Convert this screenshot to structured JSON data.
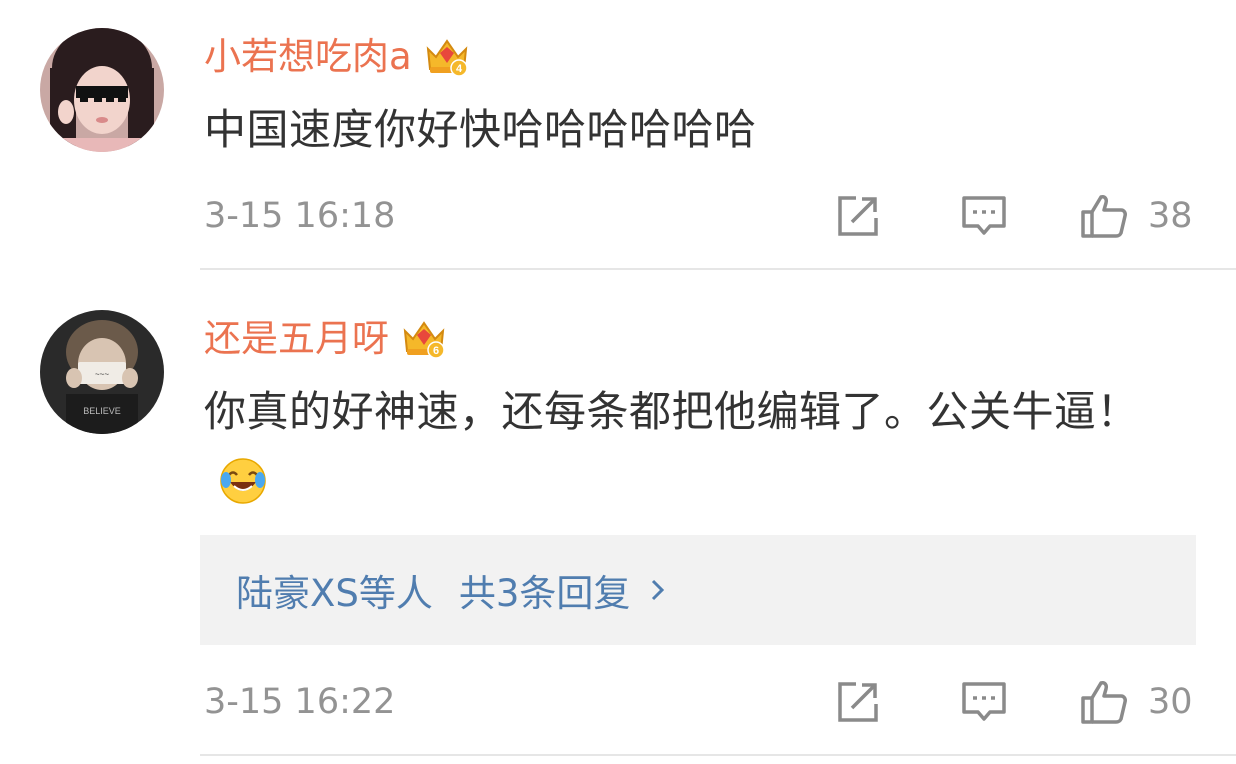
{
  "comments": [
    {
      "username": "小若想吃肉a",
      "vip_level": "4",
      "text": "中国速度你好快哈哈哈哈哈哈",
      "timestamp": "3-15 16:18",
      "likes": "38",
      "avatar_icon": "avatar-girl-sunglasses"
    },
    {
      "username": "还是五月呀",
      "vip_level": "6",
      "text": "你真的好神速，还每条都把他编辑了。公关牛逼！",
      "emoji_icon": "laugh-cry-emoji",
      "reply_names": "陆豪XS等人",
      "reply_count": "共3条回复",
      "timestamp": "3-15 16:22",
      "likes": "30",
      "avatar_icon": "avatar-boy-holding-card"
    }
  ],
  "colors": {
    "username": "#eb7350",
    "text": "#333333",
    "meta": "#939393",
    "reply_link": "#507daf",
    "reply_bg": "#f2f2f2",
    "divider": "#e6e6e6"
  }
}
